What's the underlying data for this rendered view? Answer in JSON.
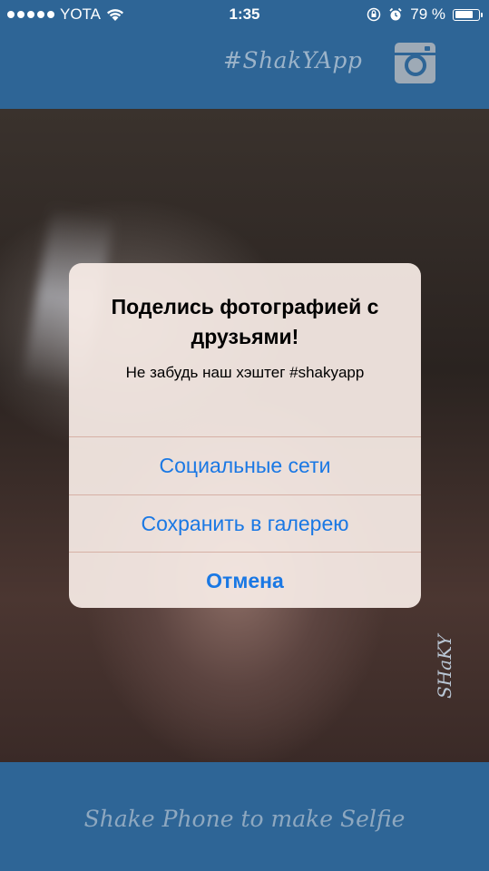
{
  "status_bar": {
    "carrier": "YOTA",
    "time": "1:35",
    "battery": "79 %",
    "battery_level": 0.79
  },
  "header": {
    "hashtag": "#ShakYApp",
    "instagram_icon": "instagram-icon"
  },
  "photo": {
    "watermark": "SHaKY"
  },
  "dialog": {
    "title": "Поделись фотографией с друзьями!",
    "message": "Не забудь наш хэштег #shakyapp",
    "actions": [
      {
        "label": "Социальные сети"
      },
      {
        "label": "Сохранить в галерею"
      },
      {
        "label": "Отмена"
      }
    ],
    "action_color": "#1a78e4"
  },
  "footer": {
    "text": "Shake Phone to make Selfie"
  },
  "colors": {
    "brand_blue": "#2e6596"
  }
}
